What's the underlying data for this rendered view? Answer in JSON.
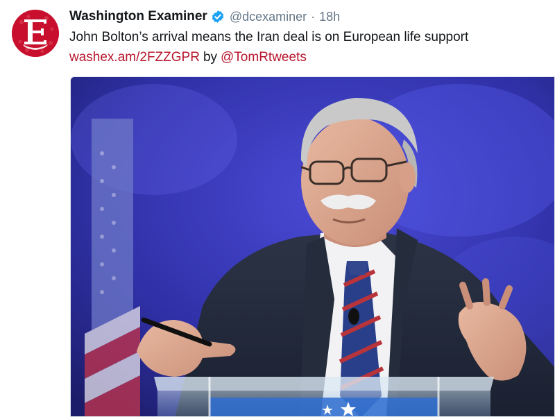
{
  "tweet": {
    "account_name": "Washington Examiner",
    "handle": "@dcexaminer",
    "separator": "·",
    "time": "18h",
    "text": "John Bolton’s arrival means the Iran deal is on European life support",
    "link": "washex.am/2FZZGPR",
    "by": "by",
    "mention": "@TomRtweets"
  },
  "avatar": {
    "letter": "E",
    "color": "#c8102e"
  },
  "icons": {
    "verified": "verified-badge-icon"
  },
  "colors": {
    "link": "#b8172e",
    "muted": "#657786",
    "verified": "#1da1f2"
  }
}
